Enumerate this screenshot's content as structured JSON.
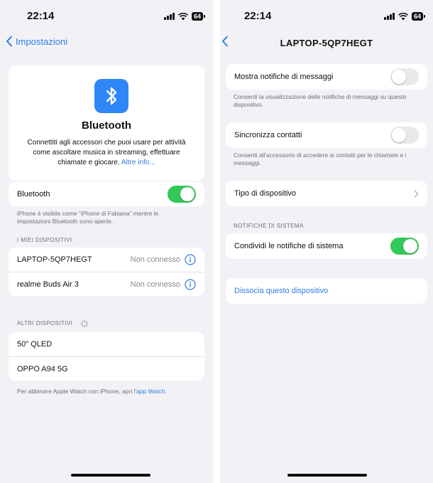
{
  "left": {
    "status": {
      "time": "22:14",
      "battery": "64"
    },
    "nav": {
      "back_label": "Impostazioni"
    },
    "bluetooth_card": {
      "title": "Bluetooth",
      "description": "Connettiti agli accessori che puoi usare per attività come ascoltare musica in streaming, effettuare chiamate e giocare.",
      "more_link": "Altre info..."
    },
    "bluetooth_toggle": {
      "label": "Bluetooth",
      "on": true
    },
    "visibility_note": "iPhone è visibile come \"iPhone di Fabiana\" mentre le impostazioni Bluetooth sono aperte.",
    "my_devices": {
      "header": "I MIEI DISPOSITIVI",
      "items": [
        {
          "name": "LAPTOP-5QP7HEGT",
          "status": "Non connesso"
        },
        {
          "name": "realme Buds Air 3",
          "status": "Non connesso"
        }
      ]
    },
    "other_devices": {
      "header": "ALTRI DISPOSITIVI",
      "items": [
        {
          "name": "50\" QLED"
        },
        {
          "name": "OPPO A94 5G"
        }
      ]
    },
    "watch_note": "Per abbinare Apple Watch con iPhone, apri l'",
    "watch_link": "app Watch",
    "watch_note_end": "."
  },
  "right": {
    "status": {
      "time": "22:14",
      "battery": "64"
    },
    "nav": {
      "title": "LAPTOP-5QP7HEGT"
    },
    "show_notifications": {
      "label": "Mostra notifiche di messaggi",
      "on": false,
      "note": "Consenti la visualizzazione delle notifiche di messaggi su questo dispositivo."
    },
    "sync_contacts": {
      "label": "Sincronizza contatti",
      "on": false,
      "note": "Consenti all'accessorio di accedere ai contatti per le chiamate e i messaggi."
    },
    "device_type": {
      "label": "Tipo di dispositivo"
    },
    "system_notifications": {
      "header": "NOTIFICHE DI SISTEMA",
      "label": "Condividi le notifiche di sistema",
      "on": true
    },
    "forget": {
      "label": "Dissocia questo dispositivo"
    }
  },
  "colors": {
    "accent": "#2f7be8",
    "toggle_on": "#34c759",
    "background": "#f2f2f6",
    "bluetooth_icon_bg": "#2f86f6"
  },
  "icons": [
    "bluetooth-icon",
    "info-icon",
    "chevron-left-icon",
    "chevron-right-icon",
    "wifi-icon",
    "signal-icon",
    "battery-icon",
    "spinner-icon"
  ]
}
